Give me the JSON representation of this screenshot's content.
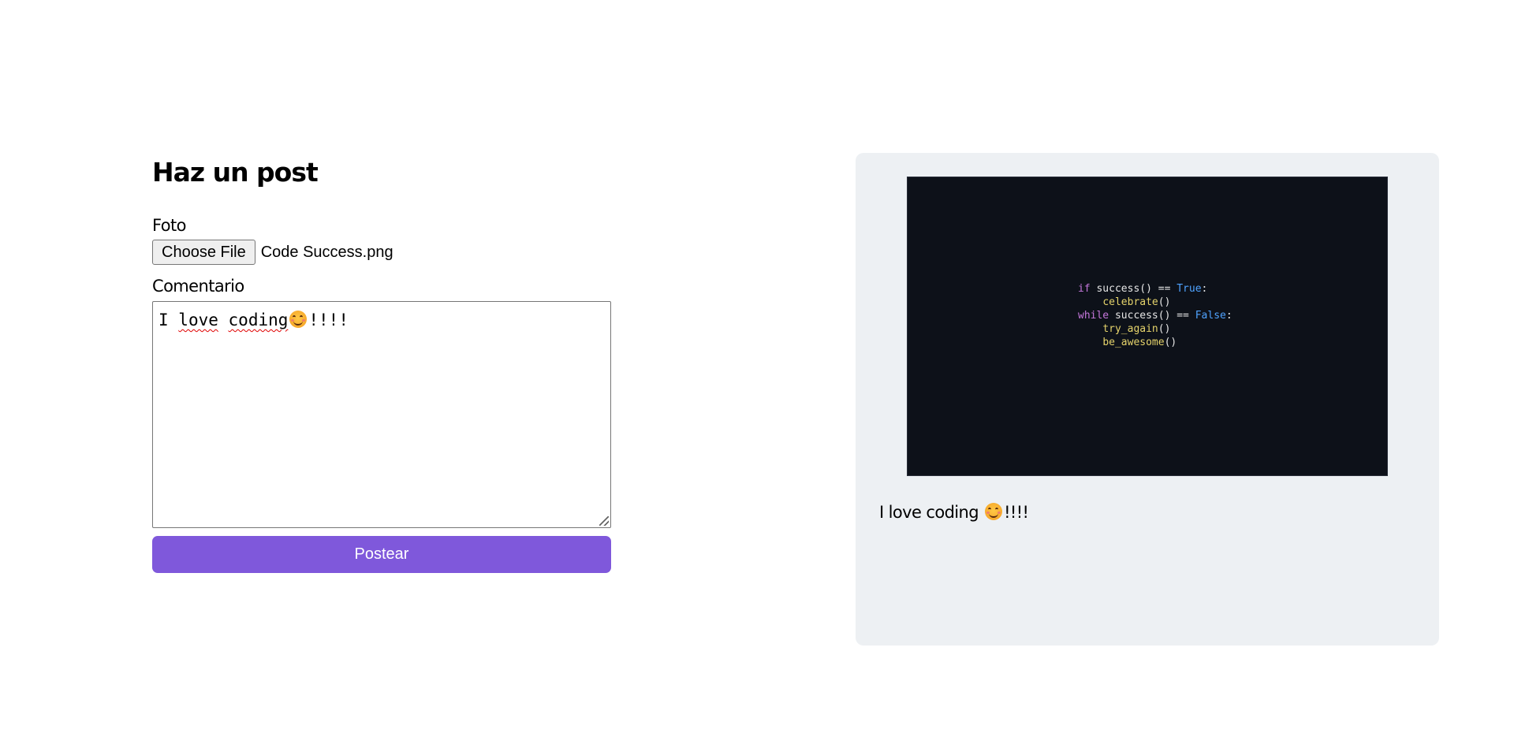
{
  "form": {
    "title": "Haz un post",
    "photo_label": "Foto",
    "file_button_label": "Choose File",
    "file_name": "Code Success.png",
    "comment_label": "Comentario",
    "comment_text_a": "I ",
    "comment_word_1": "love",
    "comment_text_b": " ",
    "comment_word_2": "coding",
    "comment_emoji": "smiling-face-icon",
    "comment_text_c": "!!!!",
    "submit_label": "Postear",
    "accent_color": "#7f58db"
  },
  "preview": {
    "image_code_lines": [
      {
        "kw": "if",
        "a": " success() == ",
        "bool": "True",
        "b": ":"
      },
      {
        "fn": "celebrate",
        "b": "()"
      },
      {
        "kw": "while",
        "a": " success() == ",
        "bool": "False",
        "b": ":"
      },
      {
        "fn": "try_again",
        "b": "()"
      },
      {
        "fn": "be_awesome",
        "b": "()"
      }
    ],
    "caption_text": "I love coding",
    "caption_emoji": "smiling-face-icon",
    "caption_suffix": "!!!!",
    "background_color": "#edf0f3"
  }
}
